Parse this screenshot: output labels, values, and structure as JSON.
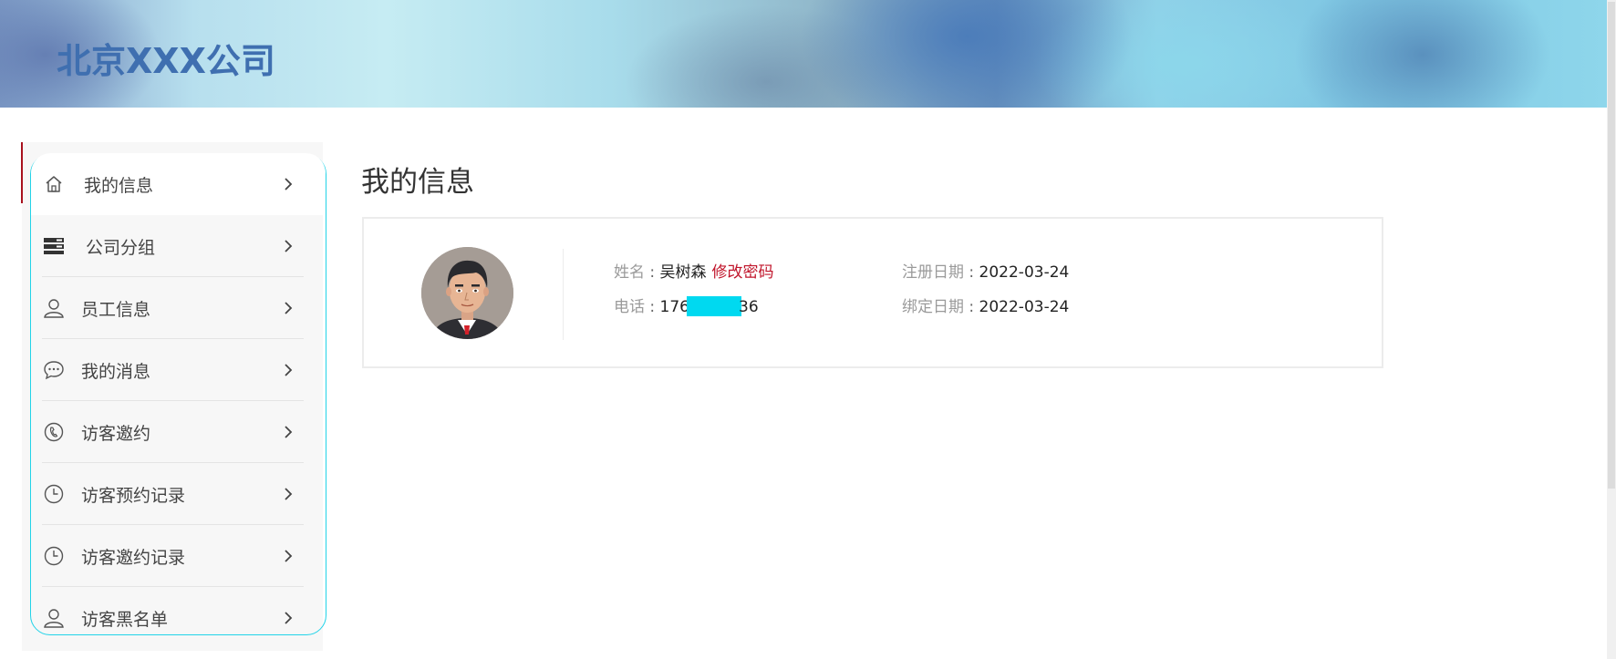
{
  "header": {
    "title": "北京XXX公司"
  },
  "sidebar": {
    "items": [
      {
        "label": "我的信息",
        "icon": "home-icon"
      },
      {
        "label": "公司分组",
        "icon": "server-icon"
      },
      {
        "label": "员工信息",
        "icon": "user-icon"
      },
      {
        "label": "我的消息",
        "icon": "chat-icon"
      },
      {
        "label": "访客邀约",
        "icon": "phone-icon"
      },
      {
        "label": "访客预约记录",
        "icon": "clock-icon"
      },
      {
        "label": "访客邀约记录",
        "icon": "clock-icon"
      },
      {
        "label": "访客黑名单",
        "icon": "user-icon"
      }
    ]
  },
  "main": {
    "title": "我的信息",
    "profile": {
      "name_label": "姓名",
      "name_value": "吴树森",
      "change_password": "修改密码",
      "phone_label": "电话",
      "phone_prefix": "176",
      "phone_suffix": "36",
      "register_label": "注册日期",
      "register_value": "2022-03-24",
      "bind_label": "绑定日期",
      "bind_value": "2022-03-24"
    }
  },
  "colors": {
    "accent_red": "#c0142a",
    "sidebar_border": "#22d3e8",
    "mask": "#00d9f0",
    "header_text": "#3f6fb0"
  }
}
